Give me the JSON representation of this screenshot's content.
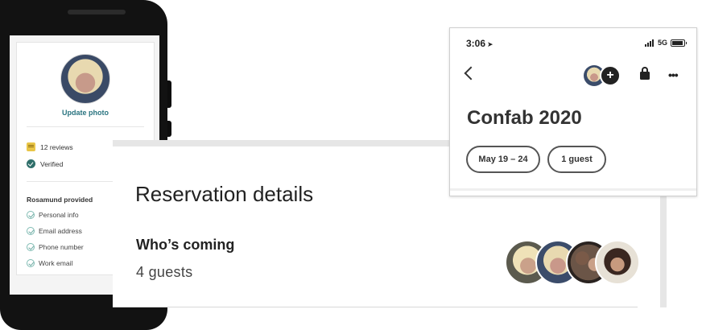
{
  "profile": {
    "update_photo_label": "Update photo",
    "reviews_label": "12 reviews",
    "verified_label": "Verified",
    "provided_title": "Rosamund provided",
    "provided_items": [
      "Personal info",
      "Email address",
      "Phone number",
      "Work email"
    ]
  },
  "reservation": {
    "title": "Reservation details",
    "whos_coming_label": "Who’s coming",
    "guests_count": "4 guests"
  },
  "trip": {
    "status_time": "3:06",
    "status_location_glyph": "➤",
    "network_label": "5G",
    "add_guest_glyph": "+",
    "more_glyph": "•••",
    "title": "Confab 2020",
    "dates_chip": "May 19 – 24",
    "guests_chip": "1 guest"
  },
  "colors": {
    "teal_link": "#2a7480",
    "verified_badge": "#2f6f6a",
    "check_outline": "#7fbbb3",
    "phone_body": "#121212"
  }
}
